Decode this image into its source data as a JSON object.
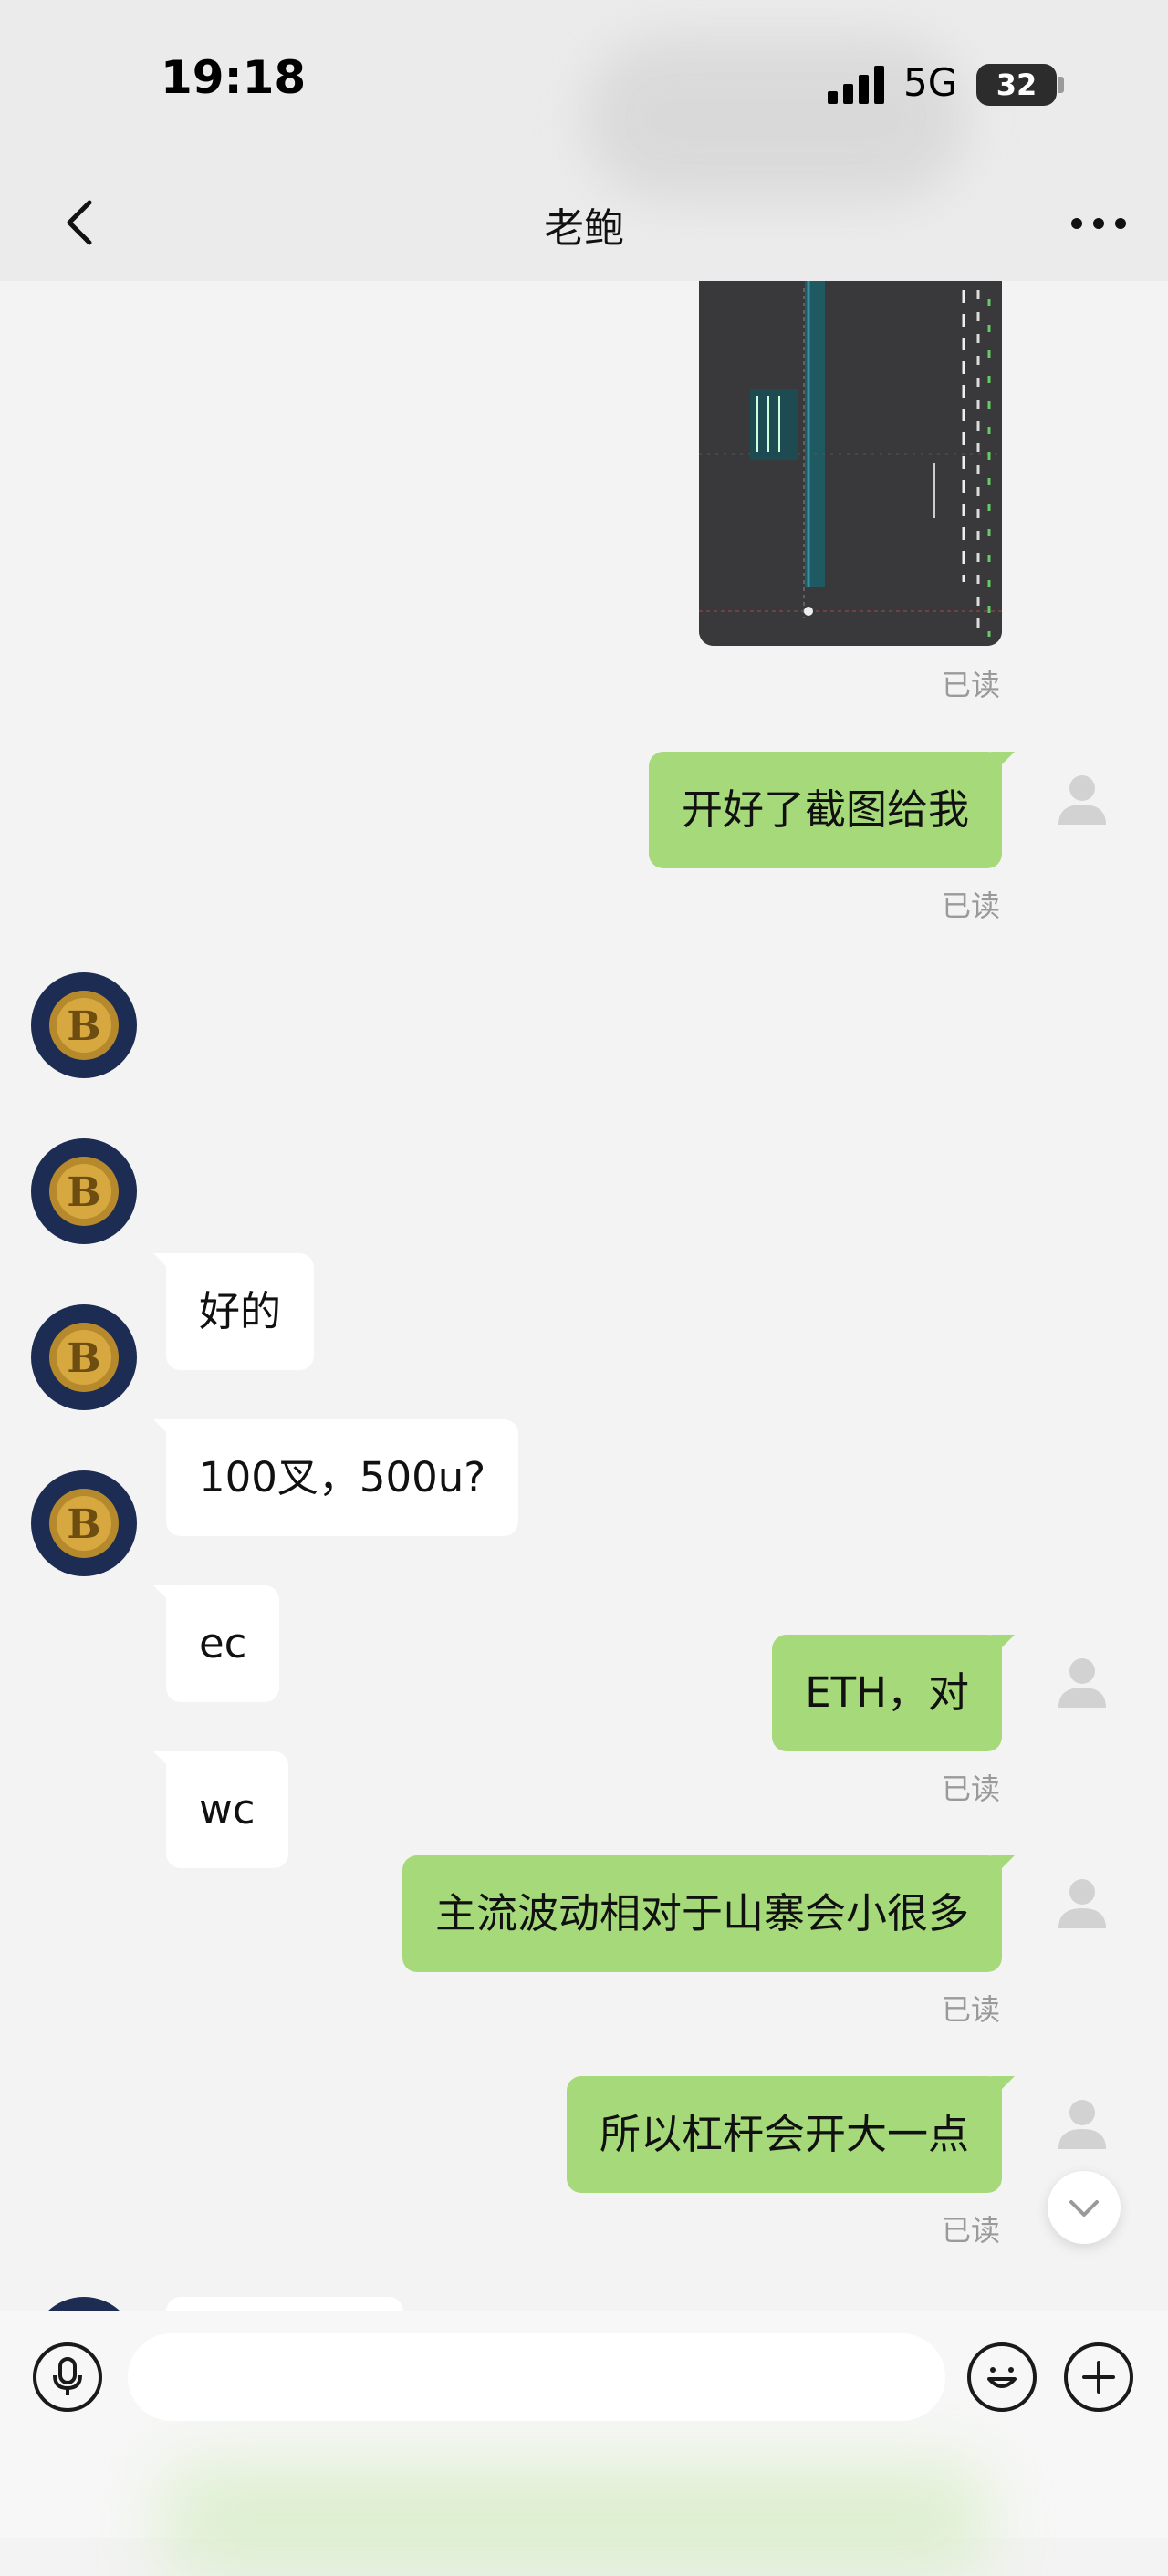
{
  "status_bar": {
    "time": "19:18",
    "network": "5G",
    "battery": "32"
  },
  "header": {
    "title": "老鲍"
  },
  "read_label": "已读",
  "messages": [
    {
      "side": "me",
      "text": "开好了截图给我"
    },
    {
      "side": "them",
      "text": "好的"
    },
    {
      "side": "them",
      "text": "100叉，500u?"
    },
    {
      "side": "them",
      "text": "ec"
    },
    {
      "side": "them",
      "text": "wc"
    },
    {
      "side": "me",
      "text": "ETH，对"
    },
    {
      "side": "me",
      "text": "主流波动相对于山寨会小很多"
    },
    {
      "side": "me",
      "text": "所以杠杆会开大一点"
    }
  ],
  "input": {
    "placeholder": ""
  },
  "colors": {
    "outgoing_bubble": "#a6d97a",
    "incoming_bubble": "#ffffff",
    "background": "#f3f3f3"
  },
  "icons": [
    "back-arrow-icon",
    "more-icon",
    "voice-icon",
    "emoji-icon",
    "plus-icon",
    "chevron-down-icon",
    "bitcoin-avatar",
    "default-user-avatar"
  ]
}
